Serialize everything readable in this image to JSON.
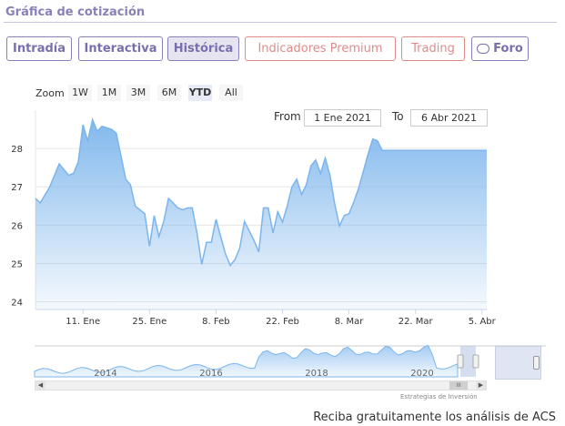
{
  "header": {
    "title": "Gráfica de cotización"
  },
  "tabs": [
    {
      "label": "Intradía",
      "style": "purple"
    },
    {
      "label": "Interactiva",
      "style": "purple"
    },
    {
      "label": "Histórica",
      "style": "active"
    },
    {
      "label": "Indicadores Premium",
      "style": "red"
    },
    {
      "label": "Trading",
      "style": "red"
    },
    {
      "label": "Foro",
      "style": "purple",
      "icon": "chat-icon"
    }
  ],
  "zoom": {
    "label": "Zoom",
    "buttons": [
      "1W",
      "1M",
      "3M",
      "6M",
      "YTD",
      "All"
    ],
    "selected": "YTD"
  },
  "range": {
    "from_label": "From",
    "from_value": "1 Ene 2021",
    "to_label": "To",
    "to_value": "6 Abr 2021"
  },
  "chart_data": {
    "type": "area",
    "title": "",
    "xlabel": "",
    "ylabel": "",
    "ylim": [
      23.8,
      29.0
    ],
    "yticks": [
      24,
      25,
      26,
      27,
      28
    ],
    "xticks": [
      {
        "x": 11,
        "label": "11. Ene"
      },
      {
        "x": 25,
        "label": "25. Ene"
      },
      {
        "x": 39,
        "label": "8. Feb"
      },
      {
        "x": 53,
        "label": "22. Feb"
      },
      {
        "x": 67,
        "label": "8. Mar"
      },
      {
        "x": 81,
        "label": "22. Mar"
      },
      {
        "x": 95,
        "label": "5. Abr"
      }
    ],
    "xlim": [
      1,
      96
    ],
    "x_unit": "day of 2021",
    "grid": true,
    "series": [
      {
        "color": "#7cb5ec",
        "x": [
          1,
          2,
          4,
          6,
          7,
          8,
          9,
          10,
          11,
          12,
          13,
          14,
          15,
          17,
          18,
          20,
          21,
          22,
          24,
          25,
          26,
          27,
          28,
          29,
          31,
          32,
          33,
          34,
          35,
          36,
          37,
          38,
          39,
          40,
          41,
          42,
          43,
          44,
          45,
          46,
          47,
          48,
          49,
          50,
          51,
          52,
          53,
          54,
          55,
          56,
          57,
          58,
          59,
          60,
          61,
          62,
          63,
          64,
          65,
          66,
          67,
          68,
          69,
          70,
          71,
          72,
          73,
          74,
          75,
          76,
          77,
          78,
          79,
          80,
          81,
          82,
          83,
          84,
          85,
          86,
          87,
          88,
          89,
          90,
          91,
          92,
          93,
          94,
          95,
          96
        ],
        "values": [
          26.7,
          26.58,
          27.0,
          27.6,
          27.45,
          27.3,
          27.35,
          27.65,
          28.62,
          28.2,
          28.75,
          28.45,
          28.58,
          28.5,
          28.4,
          27.2,
          27.05,
          26.5,
          26.3,
          25.45,
          26.25,
          25.7,
          26.1,
          26.7,
          26.45,
          26.4,
          26.45,
          26.45,
          25.8,
          24.98,
          25.55,
          25.55,
          26.15,
          25.7,
          25.25,
          24.95,
          25.1,
          25.4,
          26.1,
          25.85,
          25.6,
          25.3,
          26.45,
          26.45,
          25.8,
          26.35,
          26.08,
          26.5,
          27.0,
          27.2,
          26.8,
          27.05,
          27.55,
          27.7,
          27.35,
          27.75,
          27.3,
          26.55,
          25.98,
          26.25,
          26.3,
          26.6,
          26.95,
          27.4,
          27.85,
          28.25,
          28.2,
          27.95,
          27.95,
          27.95,
          27.95,
          27.95,
          27.95,
          27.95,
          27.95,
          27.95,
          27.95,
          27.95,
          27.95,
          27.95,
          27.95,
          27.95,
          27.95,
          27.95,
          27.95,
          27.95,
          27.95,
          27.95,
          27.95,
          27.95
        ]
      }
    ]
  },
  "navigator": {
    "year_labels": [
      "2014",
      "2016",
      "2018",
      "2020"
    ],
    "scroll_thumb_glyph": "III",
    "left_arrow": "◀",
    "right_arrow": "▶"
  },
  "credits": "Estrategias de Inversión",
  "cta": "Reciba gratuitamente los análisis de ACS"
}
